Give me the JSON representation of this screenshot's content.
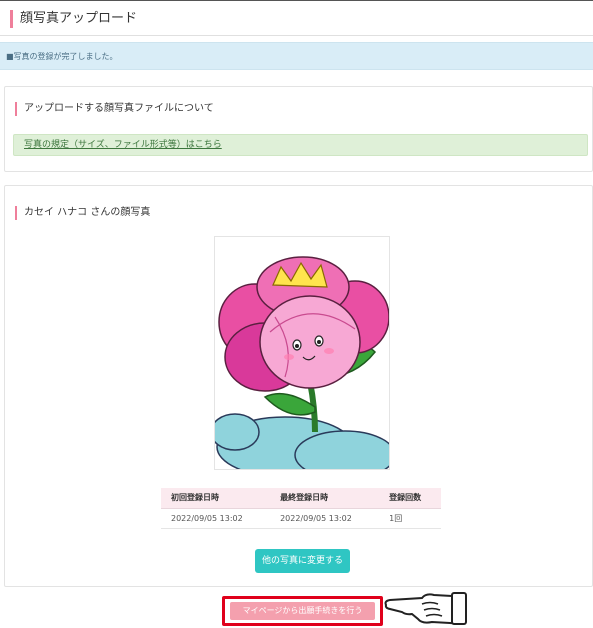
{
  "page": {
    "title": "顔写真アップロード"
  },
  "notice": {
    "text": "■写真の登録が完了しました。"
  },
  "info_section": {
    "heading": "アップロードする顔写真ファイルについて",
    "link_text": "写真の規定（サイズ、ファイル形式等）はこちら"
  },
  "photo_section": {
    "heading": "カセイ ハナコ さんの顔写真",
    "table": {
      "headers": [
        "初回登録日時",
        "最終登録日時",
        "登録回数"
      ],
      "row": [
        "2022/09/05 13:02",
        "2022/09/05 13:02",
        "1回"
      ]
    },
    "change_button": "他の写真に変更する"
  },
  "footer": {
    "mypage_button": "マイページから出願手続きを行う"
  },
  "colors": {
    "accent_pink": "#ef7f9b",
    "teal_button": "#2fc6c3",
    "highlight_red": "#e0001b",
    "notice_blue": "#d9edf7",
    "info_green": "#dff0d8"
  },
  "icons": [
    "flower-character-icon",
    "pointing-hand-icon"
  ]
}
